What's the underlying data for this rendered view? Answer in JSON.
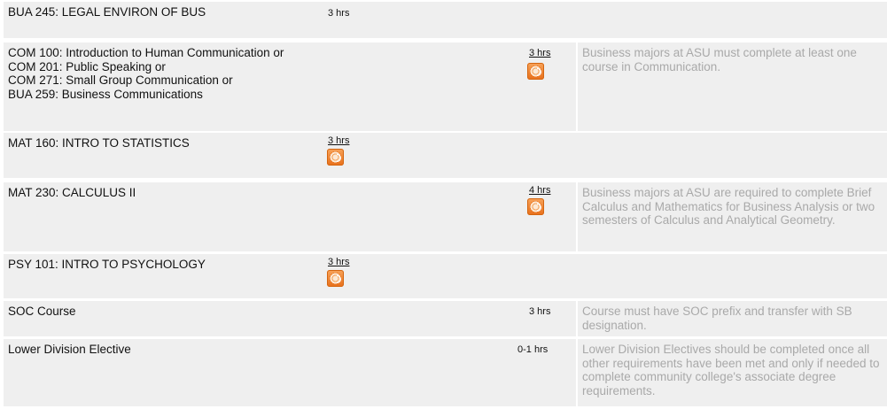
{
  "rows": [
    {
      "course": "BUA 245: LEGAL ENVIRON OF BUS",
      "hours": "3 hrs",
      "note": ""
    },
    {
      "course": "COM 100: Introduction to Human Communication or\nCOM 201: Public Speaking or\nCOM 271: Small Group Communication or\nBUA 259: Business Communications",
      "hours": "3 hrs",
      "note": "Business majors at ASU must complete at least one course in Communication."
    },
    {
      "course": "MAT 160: INTRO TO STATISTICS",
      "hours": "3 hrs",
      "note": ""
    },
    {
      "course": "MAT 230: CALCULUS II",
      "hours": "4 hrs",
      "note": "Business majors at ASU are required to complete Brief Calculus and Mathematics for Business Analysis or two semesters of Calculus and Analytical Geometry."
    },
    {
      "course": "PSY 101: INTRO TO PSYCHOLOGY",
      "hours": "3 hrs",
      "note": ""
    },
    {
      "course": "SOC Course",
      "hours": "3 hrs",
      "note": "Course must have SOC prefix and transfer with SB designation."
    },
    {
      "course": "Lower Division Elective",
      "hours": "0-1 hrs",
      "note": "Lower Division Electives should be completed once all other requirements have been met and only if needed to complete community college's associate degree requirements."
    }
  ],
  "icons": {
    "audio": "audio-speaker-icon"
  },
  "colors": {
    "cell_bg": "#efefef",
    "note_text": "#a9a9a9",
    "audio_orange": "#e86f1a"
  }
}
